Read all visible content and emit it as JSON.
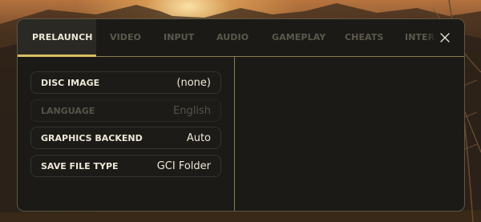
{
  "tabs": [
    {
      "label": "PRELAUNCH",
      "active": true
    },
    {
      "label": "VIDEO",
      "active": false
    },
    {
      "label": "INPUT",
      "active": false
    },
    {
      "label": "AUDIO",
      "active": false
    },
    {
      "label": "GAMEPLAY",
      "active": false
    },
    {
      "label": "CHEATS",
      "active": false
    },
    {
      "label": "INTERFACE",
      "active": false
    }
  ],
  "close": {
    "icon": "close-icon"
  },
  "settings": [
    {
      "label": "DISC IMAGE",
      "value": "(none)",
      "enabled": true
    },
    {
      "label": "LANGUAGE",
      "value": "English",
      "enabled": false
    },
    {
      "label": "GRAPHICS BACKEND",
      "value": "Auto",
      "enabled": true
    },
    {
      "label": "SAVE FILE TYPE",
      "value": "GCI Folder",
      "enabled": true
    }
  ],
  "colors": {
    "accent": "#d8bf63",
    "panel": "#1b1a16",
    "text": "#ece7d8",
    "text_disabled": "#56534a"
  }
}
